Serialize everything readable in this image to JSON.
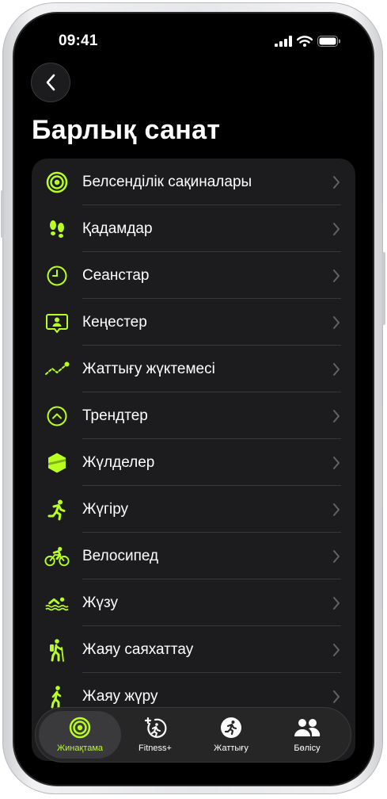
{
  "status_bar": {
    "time": "09:41"
  },
  "header": {
    "title": "Барлық санат"
  },
  "accent_color": "#b8ff1f",
  "categories": [
    {
      "label": "Белсенділік сақиналары",
      "icon": "activity-rings-icon"
    },
    {
      "label": "Қадамдар",
      "icon": "footprints-icon"
    },
    {
      "label": "Сеанстар",
      "icon": "clock-icon"
    },
    {
      "label": "Кеңестер",
      "icon": "coaching-tips-icon"
    },
    {
      "label": "Жаттығу жүктемесі",
      "icon": "training-load-icon"
    },
    {
      "label": "Трендтер",
      "icon": "trends-icon"
    },
    {
      "label": "Жүлделер",
      "icon": "awards-icon"
    },
    {
      "label": "Жүгіру",
      "icon": "running-icon"
    },
    {
      "label": "Велосипед",
      "icon": "cycling-icon"
    },
    {
      "label": "Жүзу",
      "icon": "swimming-icon"
    },
    {
      "label": "Жаяу саяхаттау",
      "icon": "hiking-icon"
    },
    {
      "label": "Жаяу жүру",
      "icon": "walking-icon"
    }
  ],
  "tabs": [
    {
      "label": "Жинақтама",
      "icon": "summary-rings-icon",
      "active": true
    },
    {
      "label": "Fitness+",
      "icon": "fitness-plus-icon",
      "active": false
    },
    {
      "label": "Жаттығу",
      "icon": "workout-icon",
      "active": false
    },
    {
      "label": "Бөлісу",
      "icon": "sharing-icon",
      "active": false
    }
  ]
}
